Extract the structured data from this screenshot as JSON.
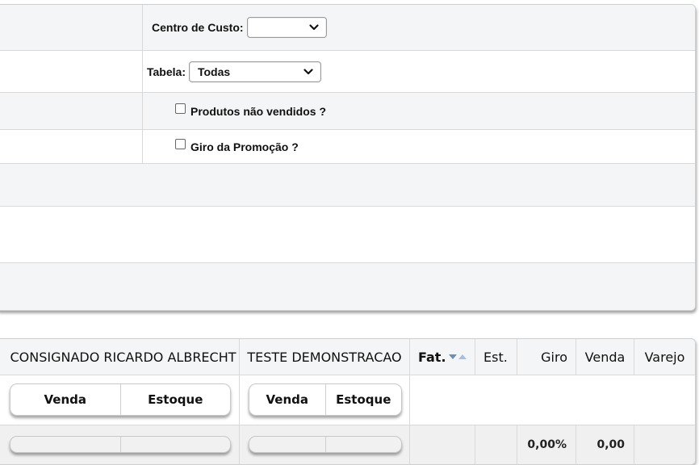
{
  "filters": {
    "centro_custo": {
      "label": "Centro de Custo:",
      "value": ""
    },
    "tabela": {
      "label": "Tabela:",
      "value": "Todas"
    },
    "produtos_nao_vendidos": {
      "label": "Produtos não vendidos ?",
      "checked": false
    },
    "giro_promocao": {
      "label": "Giro da Promoção ?",
      "checked": false
    }
  },
  "table": {
    "headers": {
      "consignado": "CONSIGNADO RICARDO ALBRECHT",
      "teste": "TESTE DEMONSTRACAO",
      "fat": "Fat.",
      "est": "Est.",
      "giro": "Giro",
      "venda": "Venda",
      "varejo": "Varejo"
    },
    "subheaders": {
      "consignado": {
        "venda": "Venda",
        "estoque": "Estoque"
      },
      "teste": {
        "venda": "Venda",
        "estoque": "Estoque"
      }
    },
    "totals": {
      "giro": "0,00%",
      "venda": "0,00"
    }
  },
  "icons": {
    "select_arrow": "chevron-down-icon",
    "sort": "sort-arrows-icon"
  }
}
